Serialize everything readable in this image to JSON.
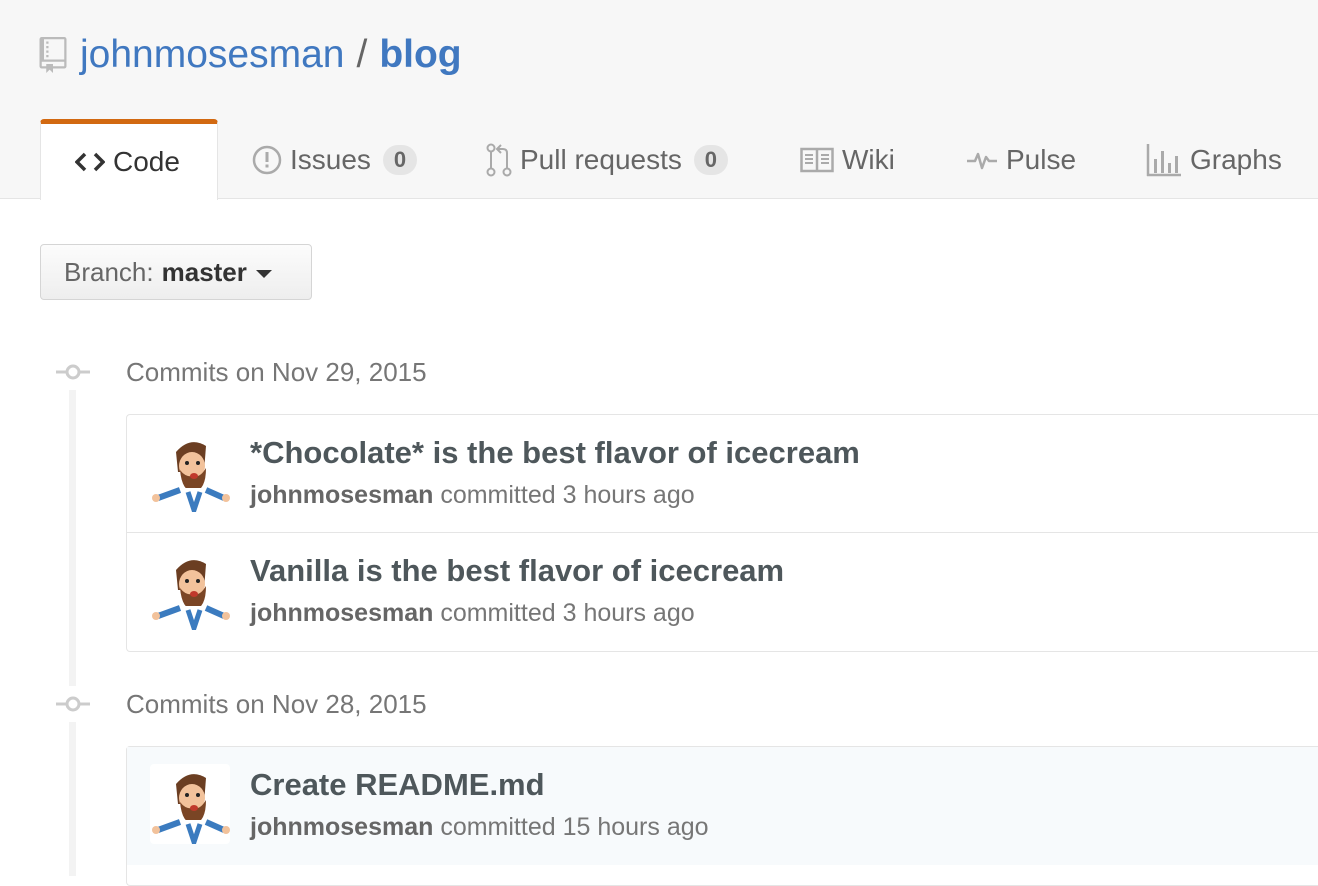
{
  "repo": {
    "owner": "johnmosesman",
    "separator": "/",
    "name": "blog"
  },
  "tabs": [
    {
      "label": "Code",
      "icon": "code-icon",
      "selected": true
    },
    {
      "label": "Issues",
      "icon": "issue-icon",
      "count": "0"
    },
    {
      "label": "Pull requests",
      "icon": "pull-request-icon",
      "count": "0"
    },
    {
      "label": "Wiki",
      "icon": "book-icon"
    },
    {
      "label": "Pulse",
      "icon": "pulse-icon"
    },
    {
      "label": "Graphs",
      "icon": "graph-icon"
    }
  ],
  "branch": {
    "prefix": "Branch:",
    "name": "master"
  },
  "commit_groups": [
    {
      "title": "Commits on Nov 29, 2015",
      "commits": [
        {
          "message": "*Chocolate* is the best flavor of icecream",
          "author": "johnmosesman",
          "verb": "committed",
          "time": "3 hours ago"
        },
        {
          "message": "Vanilla is the best flavor of icecream",
          "author": "johnmosesman",
          "verb": "committed",
          "time": "3 hours ago"
        }
      ]
    },
    {
      "title": "Commits on Nov 28, 2015",
      "commits": [
        {
          "message": "Create README.md",
          "author": "johnmosesman",
          "verb": "committed",
          "time": "15 hours ago"
        }
      ]
    }
  ],
  "colors": {
    "link": "#4078c0",
    "selected_tab_border": "#d26911",
    "page_header_bg": "#f7f7f7"
  }
}
